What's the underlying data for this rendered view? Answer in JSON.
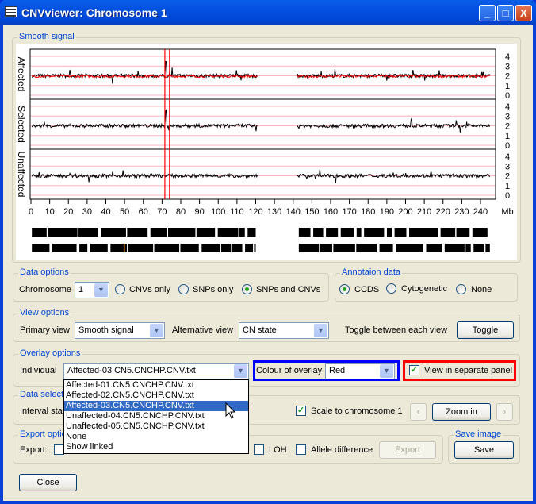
{
  "window": {
    "title": "CNVviewer: Chromosome 1",
    "minimize": "_",
    "maximize": "□",
    "close": "X"
  },
  "plot": {
    "group_label": "Smooth signal",
    "panels": [
      "Affected",
      "Selected",
      "Unaffected"
    ],
    "y_ticks": [
      "4",
      "3",
      "2",
      "1",
      "0"
    ],
    "x_ticks": [
      "0",
      "10",
      "20",
      "30",
      "40",
      "50",
      "60",
      "70",
      "80",
      "90",
      "100",
      "110",
      "120",
      "130",
      "140",
      "150",
      "160",
      "170",
      "180",
      "190",
      "200",
      "210",
      "220",
      "230",
      "240"
    ],
    "x_unit": "Mb",
    "x_range": [
      0,
      245
    ],
    "y_range": [
      0,
      5
    ],
    "baseline_cn": 2,
    "highlight_region_mb": [
      71.5,
      74
    ],
    "data_gap_mb": [
      121,
      142
    ],
    "overlay_color": "#ff0000",
    "gridline_color": "#ffb6c1"
  },
  "data_options": {
    "label": "Data options",
    "chromosome_label": "Chromosome",
    "chromosome_value": "1",
    "radios": [
      {
        "label": "CNVs only",
        "checked": false
      },
      {
        "label": "SNPs only",
        "checked": false
      },
      {
        "label": "SNPs and CNVs",
        "checked": true
      }
    ]
  },
  "annotation": {
    "label": "Annotaion data",
    "radios": [
      {
        "label": "CCDS",
        "checked": true
      },
      {
        "label": "Cytogenetic",
        "checked": false
      },
      {
        "label": "None",
        "checked": false
      }
    ]
  },
  "view_options": {
    "label": "View options",
    "primary_label": "Primary view",
    "primary_value": "Smooth signal",
    "alt_label": "Alternative view",
    "alt_value": "CN state",
    "toggle_label": "Toggle between each view",
    "toggle_button": "Toggle"
  },
  "overlay": {
    "label": "Overlay options",
    "individual_label": "Individual",
    "individual_value": "Affected-03.CN5.CNCHP.CNV.txt",
    "colour_label": "Colour of overlay",
    "colour_value": "Red",
    "separate_panel_label": "View in separate panel",
    "separate_panel_checked": true,
    "options": [
      "Affected-01.CN5.CNCHP.CNV.txt",
      "Affected-02.CN5.CNCHP.CNV.txt",
      "Affected-03.CN5.CNCHP.CNV.txt",
      "Unaffected-04.CN5.CNCHP.CNV.txt",
      "Unaffected-05.CN5.CNCHP.CNV.txt",
      "None",
      "Show linked"
    ],
    "selected_index": 2
  },
  "data_selection": {
    "label": "Data select",
    "interval_label": "Interval sta",
    "scale_label": "Scale to chromosome 1",
    "scale_checked": true,
    "prev": "‹",
    "zoom_in": "Zoom in",
    "next": "›"
  },
  "export": {
    "label": "Export optio",
    "export_label": "Export:",
    "loh_label": "LOH",
    "allele_label": "Allele difference",
    "export_button": "Export"
  },
  "save_image": {
    "label": "Save image",
    "save_button": "Save"
  },
  "close_button": "Close",
  "colors": {
    "title_bar": "#0046d5",
    "group_label": "#0046d5",
    "highlight_blue": "#0000ff",
    "highlight_red": "#ff0000",
    "selection": "#316ac5"
  }
}
